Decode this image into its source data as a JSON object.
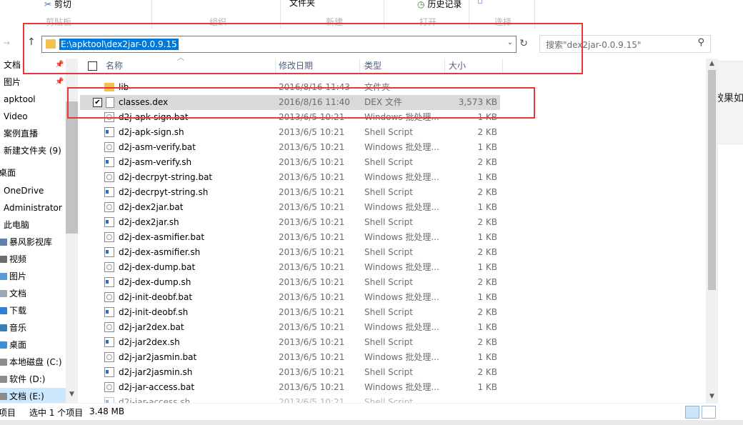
{
  "ribbon": {
    "cut_label": "剪切",
    "file_label": "文件夹",
    "history_label": "历史记录",
    "groups": [
      "剪贴板",
      "组织",
      "新建",
      "打开",
      "选择"
    ]
  },
  "address": {
    "path": "E:\\apktool\\dex2jar-0.0.9.15",
    "search_placeholder": "搜索\"dex2jar-0.0.9.15\""
  },
  "background_window": {
    "text": "效果如"
  },
  "nav": {
    "items": [
      {
        "label": "文档",
        "pinned": true
      },
      {
        "label": "图片",
        "pinned": true
      },
      {
        "label": "apktool"
      },
      {
        "label": "Video"
      },
      {
        "label": "案例直播"
      },
      {
        "label": "新建文件夹 (9)"
      },
      {
        "label": "桌面"
      },
      {
        "label": "OneDrive"
      },
      {
        "label": "Administrator"
      },
      {
        "label": "此电脑"
      },
      {
        "label": "暴风影视库"
      },
      {
        "label": "视频"
      },
      {
        "label": "图片"
      },
      {
        "label": "文档"
      },
      {
        "label": "下载"
      },
      {
        "label": "音乐"
      },
      {
        "label": "桌面"
      },
      {
        "label": "本地磁盘 (C:)"
      },
      {
        "label": "软件 (D:)"
      },
      {
        "label": "文档 (E:)"
      }
    ]
  },
  "columns": {
    "name": "名称",
    "date": "修改日期",
    "type": "类型",
    "size": "大小"
  },
  "files": [
    {
      "name": "lib",
      "date": "2016/8/16 11:43",
      "type": "文件夹",
      "size": "",
      "icon": "folder"
    },
    {
      "name": "classes.dex",
      "date": "2016/8/16 11:40",
      "type": "DEX 文件",
      "size": "3,573 KB",
      "icon": "dex",
      "selected": true
    },
    {
      "name": "d2j-apk-sign.bat",
      "date": "2013/6/5 10:21",
      "type": "Windows 批处理...",
      "size": "1 KB",
      "icon": "bat"
    },
    {
      "name": "d2j-apk-sign.sh",
      "date": "2013/6/5 10:21",
      "type": "Shell Script",
      "size": "2 KB",
      "icon": "sh"
    },
    {
      "name": "d2j-asm-verify.bat",
      "date": "2013/6/5 10:21",
      "type": "Windows 批处理...",
      "size": "1 KB",
      "icon": "bat"
    },
    {
      "name": "d2j-asm-verify.sh",
      "date": "2013/6/5 10:21",
      "type": "Shell Script",
      "size": "2 KB",
      "icon": "sh"
    },
    {
      "name": "d2j-decrpyt-string.bat",
      "date": "2013/6/5 10:21",
      "type": "Windows 批处理...",
      "size": "1 KB",
      "icon": "bat"
    },
    {
      "name": "d2j-decrpyt-string.sh",
      "date": "2013/6/5 10:21",
      "type": "Shell Script",
      "size": "2 KB",
      "icon": "sh"
    },
    {
      "name": "d2j-dex2jar.bat",
      "date": "2013/6/5 10:21",
      "type": "Windows 批处理...",
      "size": "1 KB",
      "icon": "bat"
    },
    {
      "name": "d2j-dex2jar.sh",
      "date": "2013/6/5 10:21",
      "type": "Shell Script",
      "size": "2 KB",
      "icon": "sh"
    },
    {
      "name": "d2j-dex-asmifier.bat",
      "date": "2013/6/5 10:21",
      "type": "Windows 批处理...",
      "size": "1 KB",
      "icon": "bat"
    },
    {
      "name": "d2j-dex-asmifier.sh",
      "date": "2013/6/5 10:21",
      "type": "Shell Script",
      "size": "2 KB",
      "icon": "sh"
    },
    {
      "name": "d2j-dex-dump.bat",
      "date": "2013/6/5 10:21",
      "type": "Windows 批处理...",
      "size": "1 KB",
      "icon": "bat"
    },
    {
      "name": "d2j-dex-dump.sh",
      "date": "2013/6/5 10:21",
      "type": "Shell Script",
      "size": "2 KB",
      "icon": "sh"
    },
    {
      "name": "d2j-init-deobf.bat",
      "date": "2013/6/5 10:21",
      "type": "Windows 批处理...",
      "size": "1 KB",
      "icon": "bat"
    },
    {
      "name": "d2j-init-deobf.sh",
      "date": "2013/6/5 10:21",
      "type": "Shell Script",
      "size": "2 KB",
      "icon": "sh"
    },
    {
      "name": "d2j-jar2dex.bat",
      "date": "2013/6/5 10:21",
      "type": "Windows 批处理...",
      "size": "1 KB",
      "icon": "bat"
    },
    {
      "name": "d2j-jar2dex.sh",
      "date": "2013/6/5 10:21",
      "type": "Shell Script",
      "size": "2 KB",
      "icon": "sh"
    },
    {
      "name": "d2j-jar2jasmin.bat",
      "date": "2013/6/5 10:21",
      "type": "Windows 批处理...",
      "size": "1 KB",
      "icon": "bat"
    },
    {
      "name": "d2j-jar2jasmin.sh",
      "date": "2013/6/5 10:21",
      "type": "Shell Script",
      "size": "2 KB",
      "icon": "sh"
    },
    {
      "name": "d2j-jar-access.bat",
      "date": "2013/6/5 10:21",
      "type": "Windows 批处理...",
      "size": "1 KB",
      "icon": "bat"
    },
    {
      "name": "d2j-jar-access.sh",
      "date": "2013/6/5 10:21",
      "type": "Shell Script",
      "size": "",
      "icon": "sh"
    }
  ],
  "status": {
    "items_suffix": "项目",
    "selection": "选中 1 个项目",
    "size": "3.48 MB"
  },
  "colors": {
    "accent": "#0078d7",
    "highlight": "#e8363a",
    "selected_row": "#d9d9d9"
  }
}
